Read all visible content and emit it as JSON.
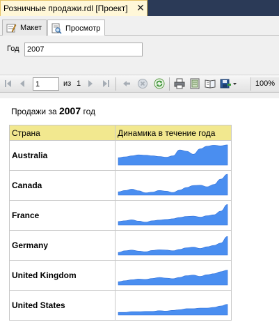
{
  "document_tab": {
    "title": "Розничные продажи.rdl [Проект]",
    "close_glyph": "✕"
  },
  "view_tabs": [
    {
      "label": "Макет",
      "icon": "design-icon",
      "active": false
    },
    {
      "label": "Просмотр",
      "icon": "preview-icon",
      "active": true
    }
  ],
  "parameters": {
    "year_label": "Год",
    "year_value": "2007"
  },
  "toolbar": {
    "page_current": "1",
    "page_of_label": "из",
    "page_total": "1",
    "zoom": "100%",
    "icons": [
      "first-page-icon",
      "prev-page-icon",
      "next-page-icon",
      "last-page-icon",
      "back-icon",
      "stop-icon",
      "refresh-icon",
      "print-icon",
      "print-layout-icon",
      "page-setup-icon",
      "export-icon"
    ]
  },
  "report": {
    "title_prefix": "Продажи за",
    "title_year": "2007",
    "title_suffix": "год",
    "columns": [
      "Страна",
      "Динамика в течение года"
    ],
    "rows": [
      {
        "country": "Australia",
        "trend": [
          4.5,
          5.0,
          5.6,
          6.2,
          6.0,
          5.6,
          5.2,
          4.8,
          5.6,
          9.2,
          8.4,
          6.6,
          9.8,
          11.4,
          12.0,
          11.6,
          12.2
        ]
      },
      {
        "country": "Canada",
        "trend": [
          2.0,
          2.8,
          3.6,
          2.6,
          1.4,
          1.8,
          2.8,
          2.4,
          1.6,
          3.0,
          4.6,
          5.8,
          6.0,
          5.0,
          6.4,
          9.6,
          12.6
        ]
      },
      {
        "country": "France",
        "trend": [
          2.2,
          2.6,
          3.2,
          2.4,
          1.8,
          2.6,
          3.0,
          3.4,
          3.8,
          4.6,
          5.2,
          5.4,
          4.8,
          5.6,
          6.2,
          8.4,
          12.4
        ]
      },
      {
        "country": "Germany",
        "trend": [
          1.6,
          2.6,
          3.0,
          2.4,
          2.0,
          2.8,
          3.2,
          3.0,
          2.6,
          3.4,
          4.4,
          4.8,
          4.0,
          5.0,
          5.8,
          7.2,
          11.2
        ]
      },
      {
        "country": "United Kingdom",
        "trend": [
          2.0,
          2.6,
          3.2,
          3.6,
          3.4,
          4.0,
          4.6,
          4.2,
          3.8,
          4.6,
          5.6,
          6.0,
          5.2,
          6.2,
          6.8,
          8.0,
          9.0
        ]
      },
      {
        "country": "United States",
        "trend": [
          1.6,
          1.6,
          2.0,
          2.0,
          2.2,
          2.2,
          2.6,
          2.4,
          2.8,
          3.2,
          3.8,
          3.8,
          4.2,
          4.2,
          4.6,
          5.4,
          6.4
        ]
      }
    ],
    "spark_color": "#4a8ef0",
    "spark_stroke": "#2f6fd8"
  }
}
